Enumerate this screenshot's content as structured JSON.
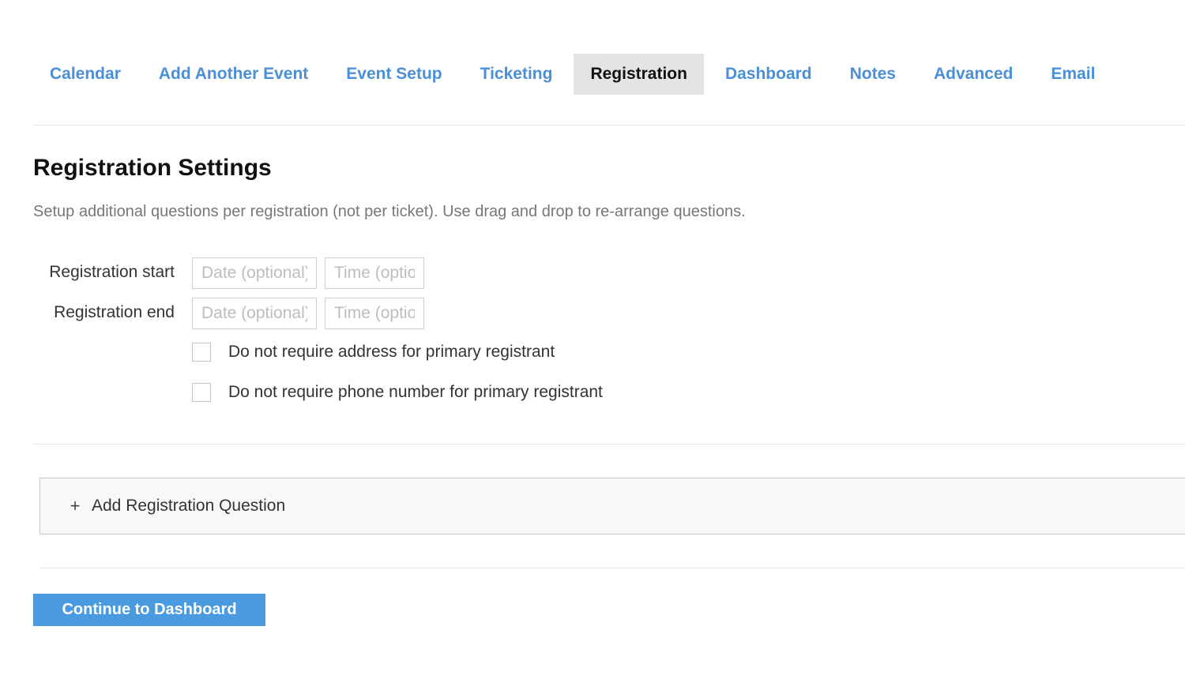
{
  "tabs": [
    {
      "label": "Calendar",
      "active": false
    },
    {
      "label": "Add Another Event",
      "active": false
    },
    {
      "label": "Event Setup",
      "active": false
    },
    {
      "label": "Ticketing",
      "active": false
    },
    {
      "label": "Registration",
      "active": true
    },
    {
      "label": "Dashboard",
      "active": false
    },
    {
      "label": "Notes",
      "active": false
    },
    {
      "label": "Advanced",
      "active": false
    },
    {
      "label": "Email",
      "active": false
    }
  ],
  "colors": {
    "tab_link": "#4a8fd8",
    "tab_active_bg": "#e4e4e4",
    "primary_button": "#4a9ae0"
  },
  "section": {
    "title": "Registration Settings",
    "description": "Setup additional questions per registration (not per ticket). Use drag and drop to re-arrange questions."
  },
  "form": {
    "start": {
      "label": "Registration start",
      "date_placeholder": "Date (optional)",
      "time_placeholder": "Time (optional)",
      "date_value": "",
      "time_value": ""
    },
    "end": {
      "label": "Registration end",
      "date_placeholder": "Date (optional)",
      "time_placeholder": "Time (optional)",
      "date_value": "",
      "time_value": ""
    },
    "checkboxes": [
      {
        "label": "Do not require address for primary registrant",
        "checked": false
      },
      {
        "label": "Do not require phone number for primary registrant",
        "checked": false
      }
    ]
  },
  "add_question": {
    "icon": "plus-icon",
    "label": "Add Registration Question"
  },
  "continue_button": {
    "label": "Continue to Dashboard"
  }
}
